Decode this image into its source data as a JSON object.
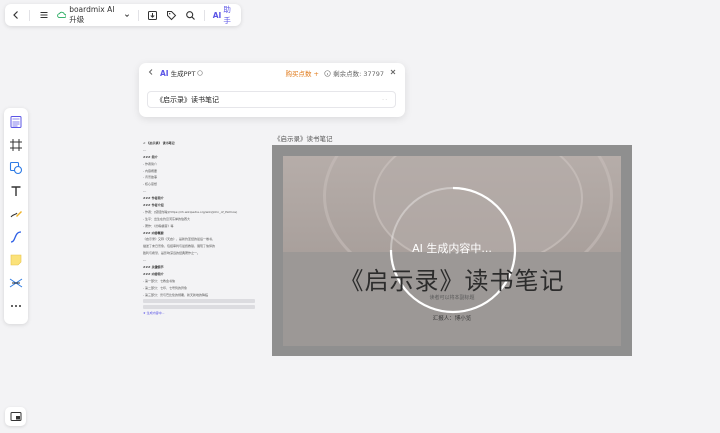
{
  "topbar": {
    "file_name": "boardmix AI升级",
    "ai_label": "AI",
    "ai_sub": "助手"
  },
  "ai_panel": {
    "title_ai": "AI",
    "title_text": "生成PPT",
    "buy_label": "购买点数",
    "remain_label": "剩余点数: 37797",
    "input_value": "《启示录》读书笔记",
    "input_hint": "· ·"
  },
  "doc": {
    "lines": [
      {
        "text": "< 《启示录》 读书笔记",
        "cls": "h"
      },
      {
        "text": "---",
        "cls": ""
      },
      {
        "text": "### 简介",
        "cls": "h"
      },
      {
        "text": "- 作者简介",
        "cls": ""
      },
      {
        "text": "- 内容概要",
        "cls": ""
      },
      {
        "text": "- 背景故事",
        "cls": ""
      },
      {
        "text": "- 核心思想",
        "cls": ""
      },
      {
        "text": "---",
        "cls": ""
      },
      {
        "text": "### 作者简介",
        "cls": "h"
      },
      {
        "text": "### 作者介绍",
        "cls": "h"
      },
      {
        "text": "- 作者：[使徒约翰](https://zh.wikipedia.org/wiki/John_of_Patmos)",
        "cls": ""
      },
      {
        "text": "- 生平：出生在约旦河东岸的伯赛大",
        "cls": ""
      },
      {
        "text": "- 著作：《约翰福音》等",
        "cls": ""
      },
      {
        "text": "### 内容概要",
        "cls": "h"
      },
      {
        "text": "《启示录》又称《天启》，是新约圣经的最后一卷书，",
        "cls": ""
      },
      {
        "text": "描述了末日景象，包括审判与最终救赎，展现了信仰的",
        "cls": ""
      },
      {
        "text": "胜利与希望，是影响深远的经典著作之一。",
        "cls": ""
      },
      {
        "text": "---",
        "cls": ""
      },
      {
        "text": "### 关键情节",
        "cls": "h"
      },
      {
        "text": "### 内容简介",
        "cls": "h"
      },
      {
        "text": "- 第一部分：七教会书信",
        "cls": ""
      },
      {
        "text": "- 第二部分：七印、七号筒的异象",
        "cls": ""
      },
      {
        "text": "- 第三部分：兽与巴比伦的倾覆，新天新地的降临",
        "cls": ""
      },
      {
        "text": "",
        "cls": "bar"
      },
      {
        "text": "",
        "cls": "bar"
      },
      {
        "text": "★ 生成内容中...",
        "cls": "hl"
      }
    ]
  },
  "slide": {
    "frame_label": "《启示录》读书笔记",
    "title": "《启示录》读书笔记",
    "subtitle": "读者可以将本副标题",
    "author": "汇报人：博小览",
    "generating_text": "AI 生成内容中..."
  }
}
